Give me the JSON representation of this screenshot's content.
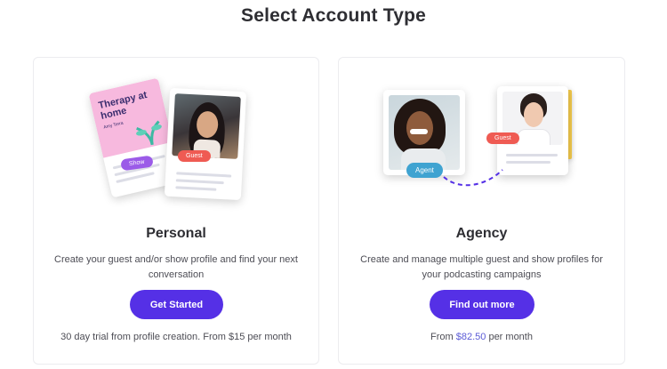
{
  "page": {
    "title": "Select Account Type"
  },
  "personal": {
    "title": "Personal",
    "description": "Create your guest and/or show profile and find your next conversation",
    "button_label": "Get Started",
    "footnote": "30 day trial from profile creation. From $15 per month",
    "illustration": {
      "show_title": "Therapy at home",
      "show_sub": "Amy Terra",
      "show_badge": "Show",
      "guest_badge": "Guest"
    }
  },
  "agency": {
    "title": "Agency",
    "description": "Create and manage multiple guest and show profiles for your podcasting campaigns",
    "button_label": "Find out more",
    "footnote_prefix": "From ",
    "footnote_price": "$82.50",
    "footnote_suffix": " per month",
    "illustration": {
      "agent_badge": "Agent",
      "guest_badge": "Guest"
    }
  },
  "colors": {
    "accent": "#5530e6",
    "price": "#5b5bd6",
    "guest_badge": "#ef5b53",
    "show_badge": "#9b5be8",
    "agent_badge": "#3fa3d1",
    "show_card_pink": "#f7b9de"
  }
}
